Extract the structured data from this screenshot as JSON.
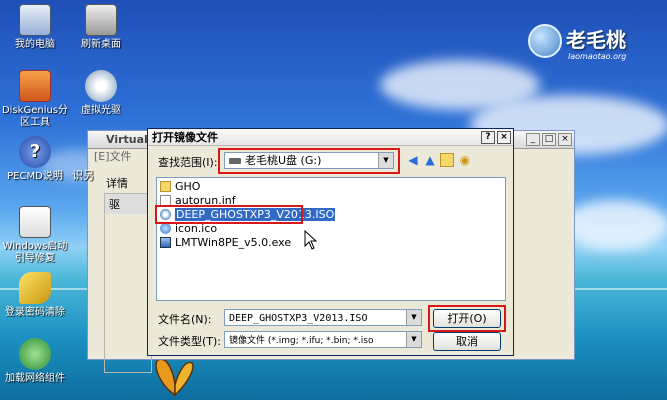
{
  "desktop": {
    "icons": [
      {
        "label": "我的电脑",
        "icon": "my-computer-icon"
      },
      {
        "label": "刷新桌面",
        "icon": "refresh-desktop-icon"
      },
      {
        "label": "DiskGenius分区工具",
        "label1": "DiskGenius分",
        "label2": "区工具",
        "icon": "diskgenius-icon"
      },
      {
        "label": "虚拟光驱",
        "icon": "virtual-cdrom-icon"
      },
      {
        "label": "PECMD说明",
        "icon": "help-icon"
      },
      {
        "label": "Windows启动引导修复",
        "label1": "Windows启动",
        "label2": "引导修复",
        "icon": "windows-repair-icon"
      },
      {
        "label": "登录密码清除",
        "icon": "key-icon"
      },
      {
        "label": "加载网络组件",
        "icon": "network-icon"
      }
    ],
    "logo": {
      "name": "老毛桃",
      "url": "laomaotao.org"
    }
  },
  "background_window": {
    "title": "Virtual D",
    "menu": "[E]文件",
    "side_label": "详情",
    "partial_text": "识另",
    "col_text": "驱"
  },
  "dialog": {
    "title": "打开镜像文件",
    "help_btn": "?",
    "close_btn": "×",
    "look_in_label": "查找范围(I):",
    "look_in_value": "老毛桃U盘 (G:)",
    "files": [
      {
        "name": "GHO",
        "type": "folder",
        "selected": false
      },
      {
        "name": "autorun.inf",
        "type": "inf",
        "selected": false
      },
      {
        "name": "DEEP_GHOSTXP3_V2013.ISO",
        "type": "iso",
        "selected": true
      },
      {
        "name": "icon.ico",
        "type": "ico",
        "selected": false
      },
      {
        "name": "LMTWin8PE_v5.0.exe",
        "type": "exe",
        "selected": false
      }
    ],
    "filename_label": "文件名(N):",
    "filename_value": "DEEP_GHOSTXP3_V2013.ISO",
    "filetype_label": "文件类型(T):",
    "filetype_value": "镜像文件 (*.img; *.ifu; *.bin; *.iso",
    "open_button": "打开(O)",
    "cancel_button": "取消"
  },
  "colors": {
    "highlight": "#d81818",
    "selection": "#316ac5"
  }
}
